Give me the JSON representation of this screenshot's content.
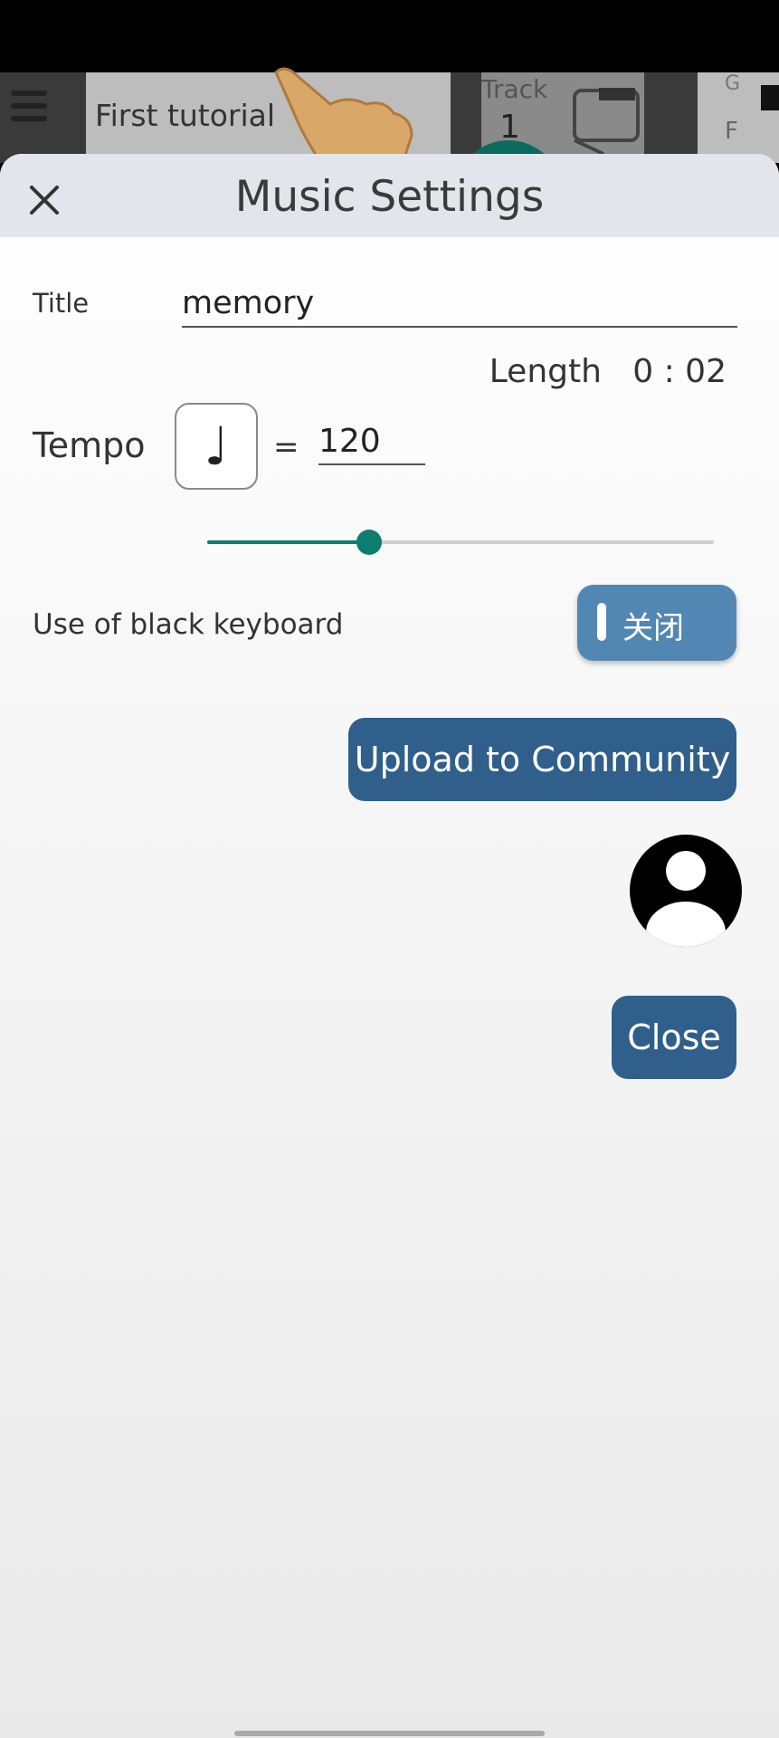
{
  "background_app": {
    "tutorial_label": "First tutorial",
    "track_label": "Track",
    "track_number": "1",
    "right_top_label": "G",
    "right_bottom_label": "F"
  },
  "modal": {
    "title": "Music Settings",
    "title_field": {
      "label": "Title",
      "value": "memory"
    },
    "length": {
      "label": "Length",
      "value": "0 : 02"
    },
    "tempo": {
      "label": "Tempo",
      "note_symbol": "♩",
      "equals": "=",
      "value": "120",
      "slider_fraction": 0.32
    },
    "black_keyboard": {
      "label": "Use of black keyboard",
      "toggle_text": "关闭",
      "state": "off"
    },
    "upload_button": "Upload to Community",
    "close_button": "Close"
  },
  "colors": {
    "accent_teal": "#0c7d70",
    "button_blue": "#2f5f8a",
    "toggle_blue": "#5287b3",
    "header_bg": "#e3e5ec"
  }
}
